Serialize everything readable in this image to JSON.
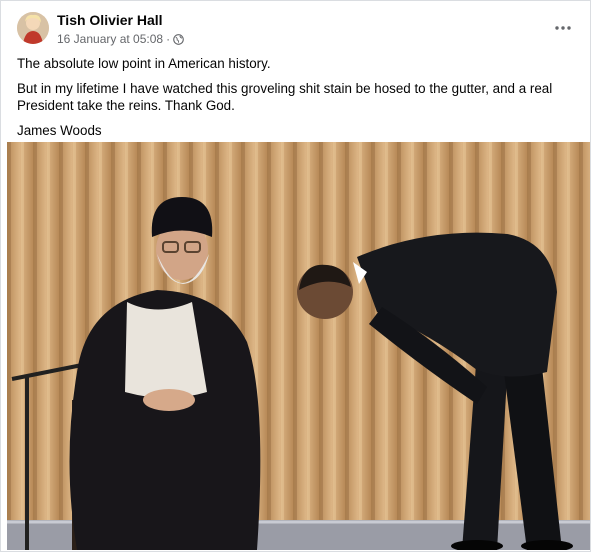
{
  "post": {
    "author": "Tish Olivier Hall",
    "timestamp": "16 January at 05:08",
    "separator": "·",
    "privacy_icon": "globe-icon",
    "more_icon": "more-options-icon",
    "paragraphs": [
      "The absolute low point in American history.",
      "But in my lifetime I have watched this groveling shit stain be hosed to the gutter, and a real President take the reins. Thank God.",
      "James Woods"
    ]
  },
  "colors": {
    "text": "#050505",
    "secondary_text": "#65676b",
    "curtain": "#c49a66",
    "suit": "#15161a"
  }
}
